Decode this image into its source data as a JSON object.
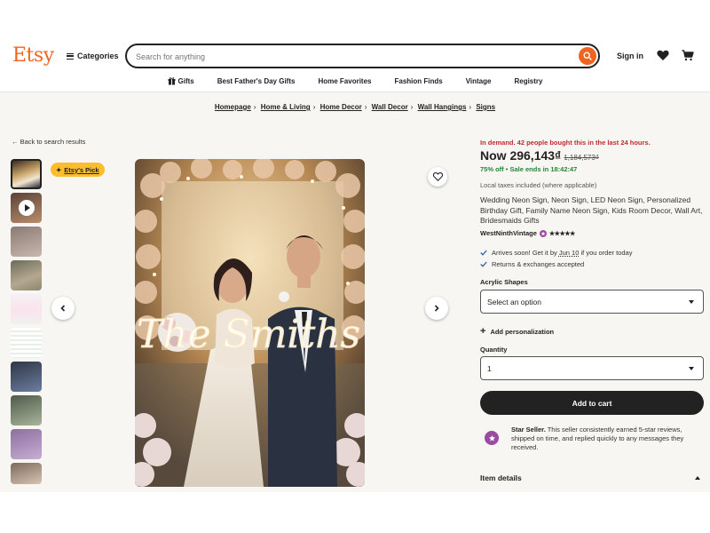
{
  "header": {
    "logo": "Etsy",
    "categories_label": "Categories",
    "search_placeholder": "Search for anything",
    "signin_label": "Sign in"
  },
  "nav": {
    "items": [
      "Gifts",
      "Best Father's Day Gifts",
      "Home Favorites",
      "Fashion Finds",
      "Vintage",
      "Registry"
    ]
  },
  "breadcrumb": [
    "Homepage",
    "Home & Living",
    "Home Decor",
    "Wall Decor",
    "Wall Hangings",
    "Signs"
  ],
  "gallery": {
    "back_label": "Back to search results",
    "badge_label": "Etsy's Pick",
    "hero_sign_text": "The Smiths"
  },
  "product": {
    "demand_text": "In demand. 42 people bought this in the last 24 hours.",
    "price_now": "Now 296,143₫",
    "price_old": "1,184,573₫",
    "discount": "75% off",
    "sale_ends": "Sale ends in 18:42:47",
    "tax_note": "Local taxes included (where applicable)",
    "title": "Wedding Neon Sign, Neon Sign, LED Neon Sign, Personalized Birthday Gift, Family Name Neon Sign, Kids Room Decor, Wall Art, Bridesmaids Gifts",
    "seller_name": "WestNinthVintage",
    "rating_stars": "★★★★★",
    "arrives_prefix": "Arrives soon! Get it by ",
    "arrives_date": "Jun 10",
    "arrives_suffix": " if you order today",
    "returns": "Returns & exchanges accepted",
    "option_label": "Acrylic Shapes",
    "option_value": "Select an option",
    "personalization_label": "Add personalization",
    "quantity_label": "Quantity",
    "quantity_value": "1",
    "add_to_cart": "Add to cart",
    "star_seller_title": "Star Seller.",
    "star_seller_text": " This seller consistently earned 5-star reviews, shipped on time, and replied quickly to any messages they received.",
    "item_details": "Item details"
  },
  "colors": {
    "brand": "#f1641e",
    "demand": "#c2282e",
    "sale": "#258635",
    "badge": "#fdbd2f",
    "star_seller": "#9a4aa0"
  }
}
